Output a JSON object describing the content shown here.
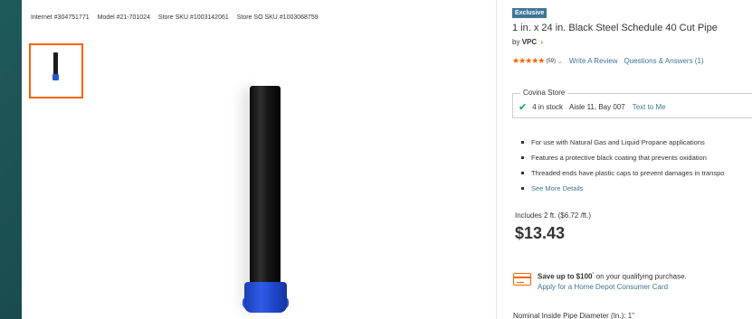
{
  "identifiers": {
    "internet": "Internet #304751771",
    "model": "Model #21-701024",
    "store_sku": "Store SKU #1003142061",
    "store_so_sku": "Store SO SKU #1003068759"
  },
  "product": {
    "badge": "Exclusive",
    "title": "1 in. x 24 in. Black Steel Schedule 40 Cut Pipe",
    "by": "by",
    "brand": "VPC",
    "brand_chevron": "›",
    "stars": "★★★★★",
    "rating_count": "(59)",
    "rating_caret": "⌄",
    "write_review": "Write A Review",
    "questions": "Questions & Answers (1)"
  },
  "store": {
    "name": "Covina Store",
    "check": "✔",
    "stock": "4 in stock",
    "aisle": "Aisle 11, Bay 007",
    "text_to_me": "Text to Me"
  },
  "bullets": [
    "For use with Natural Gas and Liquid Propane applications",
    "Features a protective black coating that prevents oxidation",
    "Threaded ends have plastic caps to prevent damages in transpo",
    "See More Details"
  ],
  "pricing": {
    "includes": "Includes 2 ft. ($6.72 /ft.)",
    "price": "$13.43"
  },
  "promo": {
    "save_bold": "Save up to $100",
    "save_sup": "°",
    "save_rest": " on your qualifying purchase.",
    "apply": "Apply for a Home Depot Consumer Card"
  },
  "spec_line": "Nominal Inside Pipe Diameter (In.): 1\"",
  "colors": {
    "accent": "#f96302",
    "link": "#3e7697",
    "badge": "#3e7697",
    "cap_blue": "#2a55d6",
    "in_stock": "#00a650"
  }
}
